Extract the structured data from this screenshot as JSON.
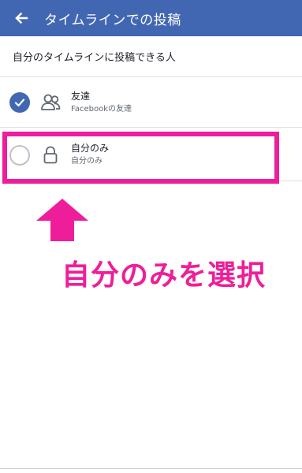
{
  "appbar": {
    "title": "タイムラインでの投稿",
    "back_icon": "arrow-left-icon",
    "background": "#4267b2"
  },
  "section": {
    "header": "自分のタイムラインに投稿できる人"
  },
  "options": [
    {
      "title": "友達",
      "subtitle": "Facebookの友達",
      "icon": "friends-icon",
      "selected": true
    },
    {
      "title": "自分のみ",
      "subtitle": "自分のみ",
      "icon": "lock-icon",
      "selected": false
    }
  ],
  "annotation": {
    "instruction": "自分のみを選択",
    "color": "#ee1e9a",
    "arrow_icon": "up-arrow-icon"
  }
}
